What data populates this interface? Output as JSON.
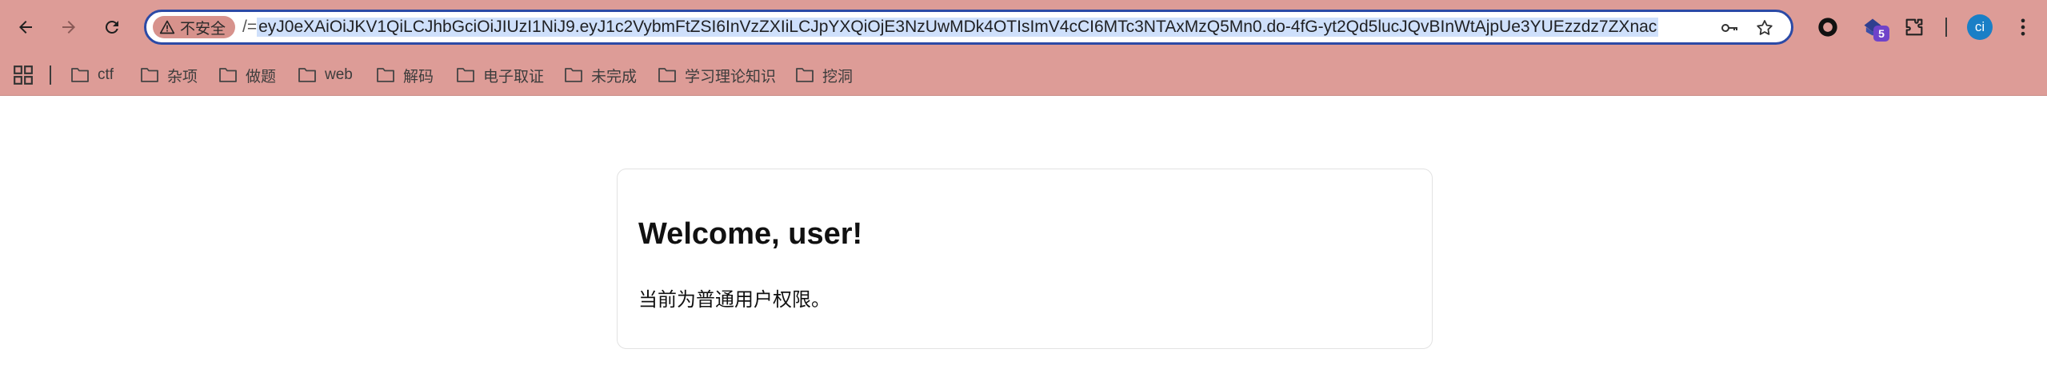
{
  "security": {
    "label": "不安全"
  },
  "address_bar": {
    "prefix": "/=",
    "url": "eyJ0eXAiOiJKV1QiLCJhbGciOiJIUzI1NiJ9.eyJ1c2VybmFtZSI6InVzZXIiLCJpYXQiOjE3NzUwMDk4OTIsImV4cCI6MTc3NTAxMzQ5Mn0.do-4fG-yt2Qd5lucJQvBInWtAjpUe3YUEzzdz7ZXnac"
  },
  "toolbar": {
    "extensions_badge": "5",
    "avatar_initials": "ci",
    "accent_color": "#2b4aa6",
    "background_color": "#dd9c97"
  },
  "bookmarks": [
    {
      "label": "ctf"
    },
    {
      "label": "杂项"
    },
    {
      "label": "做题"
    },
    {
      "label": "web"
    },
    {
      "label": "解码"
    },
    {
      "label": "电子取证"
    },
    {
      "label": "未完成"
    },
    {
      "label": "学习理论知识"
    },
    {
      "label": "挖洞"
    }
  ],
  "page": {
    "heading": "Welcome, user!",
    "message": "当前为普通用户权限。"
  }
}
